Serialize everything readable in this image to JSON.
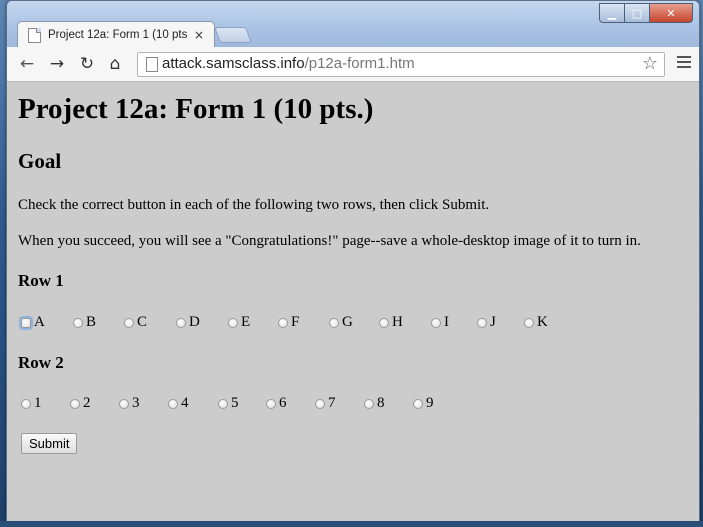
{
  "browser": {
    "tab_title": "Project 12a: Form 1 (10 pts",
    "tab_close": "×",
    "url_host": "attack.samsclass.info",
    "url_path": "/p12a-form1.htm",
    "nav": {
      "back": "←",
      "forward": "→",
      "reload": "↻",
      "home": "⌂"
    },
    "star": "☆",
    "window_controls": {
      "minimize": "▁",
      "maximize": "□",
      "close": "✕"
    }
  },
  "page": {
    "title": "Project 12a: Form 1 (10 pts.)",
    "goal_heading": "Goal",
    "instructions": "Check the correct button in each of the following two rows, then click Submit.",
    "success_note": "When you succeed, you will see a \"Congratulations!\" page--save a whole-desktop image of it to turn in.",
    "row1_heading": "Row 1",
    "row1_options": [
      "A",
      "B",
      "C",
      "D",
      "E",
      "F",
      "G",
      "H",
      "I",
      "J",
      "K"
    ],
    "row2_heading": "Row 2",
    "row2_options": [
      "1",
      "2",
      "3",
      "4",
      "5",
      "6",
      "7",
      "8",
      "9"
    ],
    "submit_label": "Submit"
  }
}
